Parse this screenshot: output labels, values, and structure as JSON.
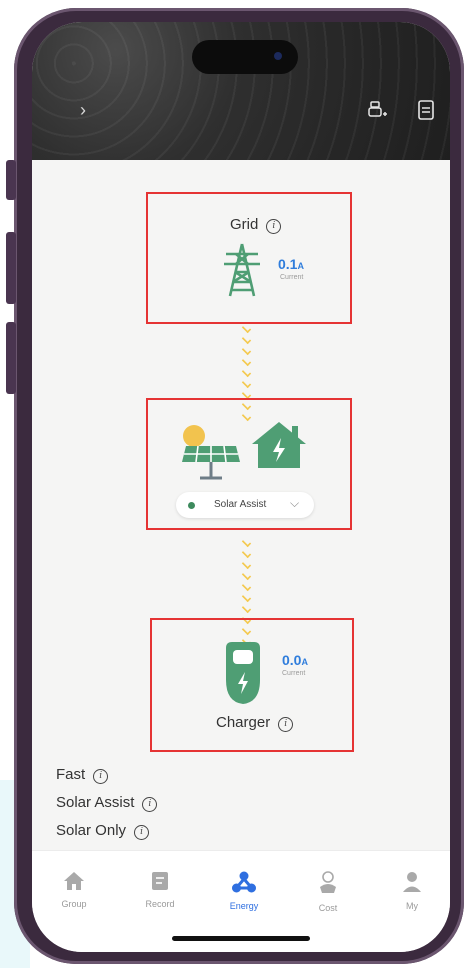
{
  "header": {
    "back_icon": "chevron-right-icon",
    "actions": [
      "add-device-icon",
      "document-icon"
    ]
  },
  "flow": {
    "grid": {
      "title": "Grid",
      "value": "0.1",
      "unit": "A",
      "caption": "Current"
    },
    "mode_selector": {
      "selected": "Solar Assist"
    },
    "charger": {
      "title": "Charger",
      "value": "0.0",
      "unit": "A",
      "caption": "Current"
    }
  },
  "modes": [
    {
      "label": "Fast"
    },
    {
      "label": "Solar Assist"
    },
    {
      "label": "Solar Only"
    }
  ],
  "tabs": [
    {
      "label": "Group",
      "icon": "home-icon"
    },
    {
      "label": "Record",
      "icon": "record-icon"
    },
    {
      "label": "Energy",
      "icon": "energy-icon",
      "active": true
    },
    {
      "label": "Cost",
      "icon": "cost-icon"
    },
    {
      "label": "My",
      "icon": "user-icon"
    }
  ],
  "colors": {
    "accent": "#2f6fe0",
    "value_blue": "#2f7ddc",
    "green": "#4f9e74",
    "highlight_red": "#e53333",
    "arrow_yellow": "#f4c94e"
  }
}
